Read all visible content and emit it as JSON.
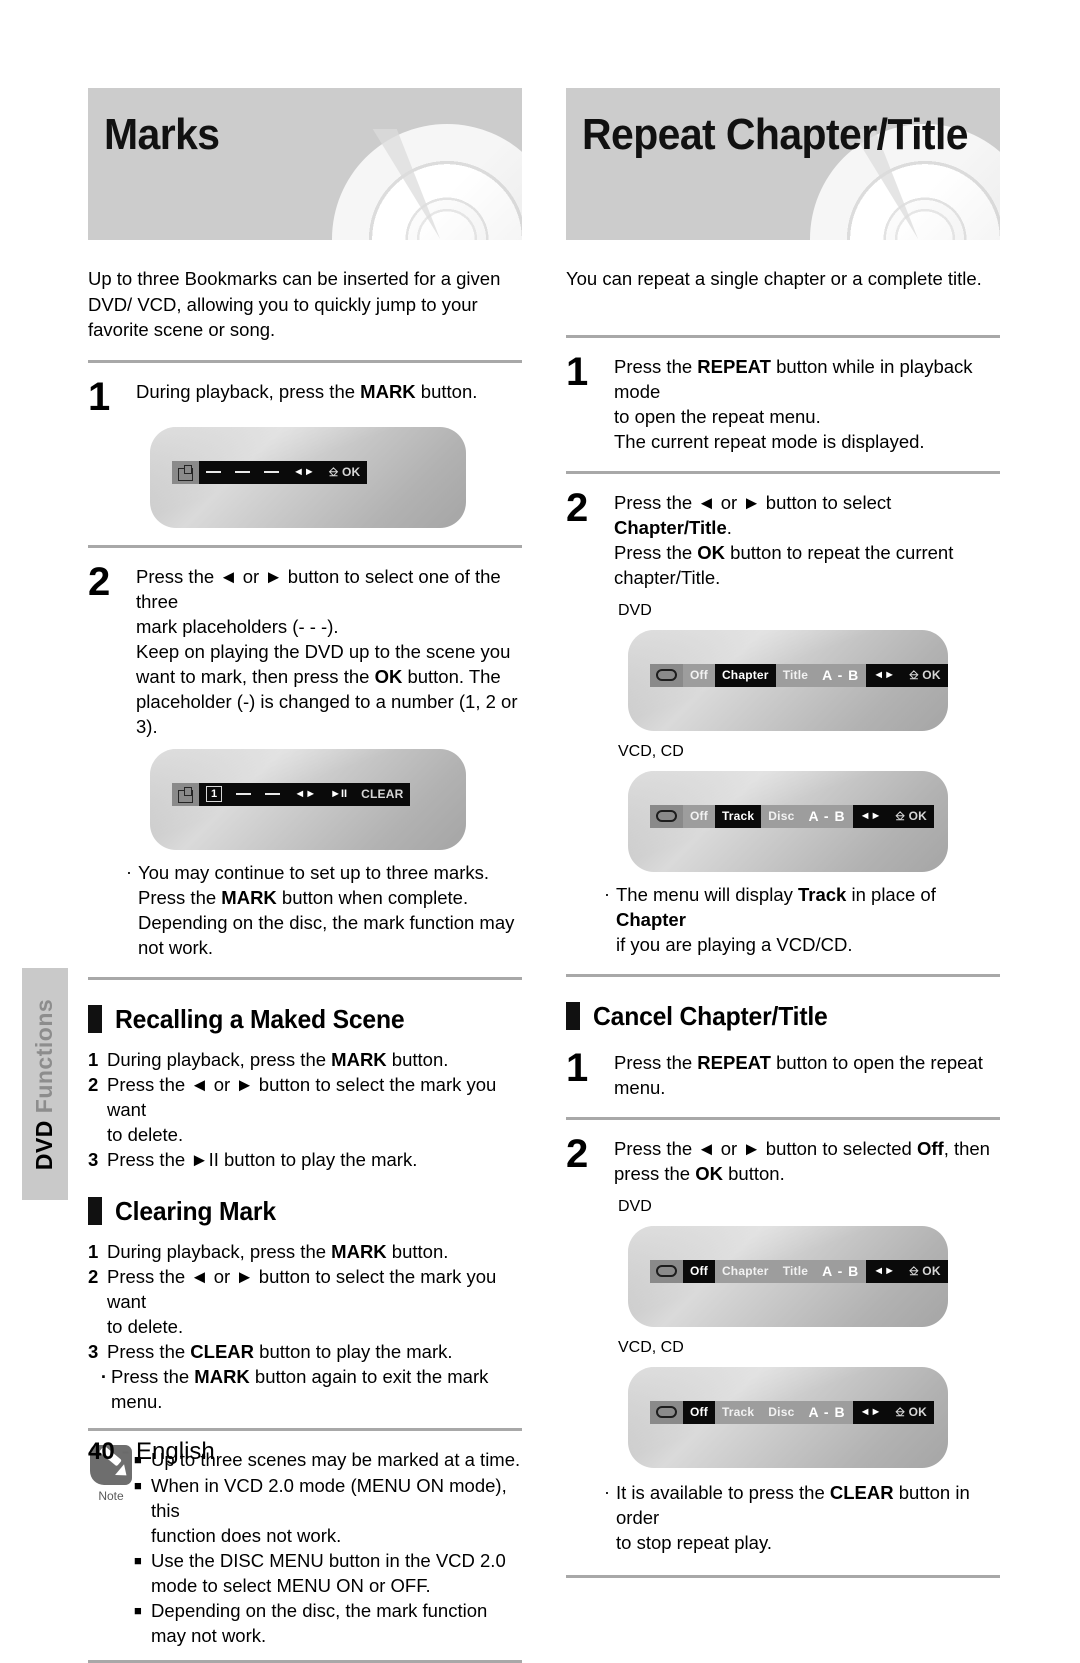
{
  "side_tab": {
    "bold_part": "DVD",
    "light_part": "Functions"
  },
  "footer": {
    "page_number": "40",
    "separator": "-",
    "language": "English"
  },
  "left": {
    "banner_title": "Marks",
    "intro": "Up to three Bookmarks can be inserted for a given DVD/ VCD, allowing you to quickly jump to your favorite scene or song.",
    "step1": {
      "number": "1",
      "line1_a": "During playback, press the ",
      "line1_b": "MARK",
      "line1_c": " button."
    },
    "osd1": {
      "icon": "mark-icon",
      "slot1": "–",
      "slot2": "–",
      "slot3": "–",
      "nav": "◄►",
      "enter": "OK"
    },
    "step2": {
      "number": "2",
      "l1a": "Press the ",
      "l1b": "◄",
      "l1c": " or ",
      "l1d": "►",
      "l1e": " button to select one of the three",
      "l2": "mark placeholders (- - -).",
      "l3": "Keep on playing the DVD up to the scene you",
      "l4a": "want to mark, then press the ",
      "l4b": "OK",
      "l4c": " button. The",
      "l5": "placeholder (-) is changed to a number (1, 2 or 3)."
    },
    "osd2": {
      "icon": "mark-icon",
      "slot1": "1",
      "slot2": "–",
      "slot3": "–",
      "nav": "◄►",
      "play": "►II",
      "clear": "CLEAR"
    },
    "bullet1": {
      "dot": "·",
      "l1": "You may continue to set up to three marks.",
      "l2a": "Press the ",
      "l2b": "MARK",
      "l2c": " button when complete.",
      "l3": "Depending on the disc, the mark function may",
      "l4": "not work."
    },
    "section_recall": {
      "title": "Recalling a Maked Scene",
      "items": [
        {
          "n": "1",
          "a": "During playback, press the ",
          "b": "MARK",
          "c": " button."
        },
        {
          "n": "2",
          "a": "Press the ◄ or ► button to select the mark you want",
          "b": "",
          "c": ""
        },
        {
          "n": "",
          "a": "to delete.",
          "b": "",
          "c": ""
        },
        {
          "n": "3",
          "a": "Press the ►II button to play the mark.",
          "b": "",
          "c": ""
        }
      ]
    },
    "section_clear": {
      "title": "Clearing Mark",
      "items": [
        {
          "n": "1",
          "a": "During playback, press the ",
          "b": "MARK",
          "c": " button."
        },
        {
          "n": "2",
          "a": "Press the ◄ or ► button to select the mark you want",
          "b": "",
          "c": ""
        },
        {
          "n": "",
          "a": "to delete.",
          "b": "",
          "c": ""
        },
        {
          "n": "3",
          "a": "Press the ",
          "b": "CLEAR",
          "c": " button to play the mark."
        }
      ],
      "sub_bullet": {
        "dot": "·",
        "a": "Press the ",
        "b": "MARK",
        "c": " button again to exit the mark menu."
      }
    },
    "note": {
      "word": "Note",
      "items": [
        {
          "sq": "■",
          "lines": [
            "Up to three scenes may be marked at a time."
          ]
        },
        {
          "sq": "■",
          "lines": [
            "When in VCD 2.0 mode (MENU ON mode), this",
            "function does not work."
          ]
        },
        {
          "sq": "■",
          "lines": [
            "Use the DISC MENU button in the VCD 2.0",
            "mode to select MENU ON or OFF."
          ]
        },
        {
          "sq": "■",
          "lines": [
            "Depending on the disc, the mark function",
            "may not work."
          ]
        }
      ]
    }
  },
  "right": {
    "banner_title": "Repeat Chapter/Title",
    "intro": "You can repeat a single chapter or a complete title.",
    "step1": {
      "number": "1",
      "l1a": "Press the ",
      "l1b": "REPEAT",
      "l1c": " button while in playback mode",
      "l2": "to open the repeat menu.",
      "l3": "The current repeat mode is displayed."
    },
    "step2": {
      "number": "2",
      "l1a": "Press the ◄ or ► button to select ",
      "l1b": "Chapter/Title",
      "l1c": ".",
      "l2a": "Press the ",
      "l2b": "OK",
      "l2c": " button to repeat the current",
      "l3": "chapter/Title."
    },
    "osd_dvd_label": "DVD",
    "osd_dvd": {
      "icon": "repeat-loop-icon",
      "off": "Off",
      "mid": "Chapter",
      "right": "Title",
      "ab": "A - B",
      "nav": "◄►",
      "enter": "OK"
    },
    "osd_vcd_label": "VCD, CD",
    "osd_vcd": {
      "icon": "repeat-loop-icon",
      "off": "Off",
      "mid": "Track",
      "right": "Disc",
      "ab": "A - B",
      "nav": "◄►",
      "enter": "OK"
    },
    "bullet1": {
      "dot": "·",
      "l1a": "The menu will display ",
      "l1b": "Track",
      "l1c": " in place of ",
      "l1d": "Chapter",
      "l2": "if you are playing a VCD/CD."
    },
    "section_cancel": {
      "title": "Cancel Chapter/Title"
    },
    "cstep1": {
      "number": "1",
      "l1a": "Press the ",
      "l1b": "REPEAT",
      "l1c": " button to open the repeat",
      "l2": "menu."
    },
    "cstep2": {
      "number": "2",
      "l1a": "Press the ◄ or ► button to selected ",
      "l1b": "Off",
      "l1c": ", then",
      "l2a": "press the ",
      "l2b": "OK",
      "l2c": " button."
    },
    "osd_dvd2_label": "DVD",
    "osd_dvd2": {
      "icon": "repeat-loop-icon",
      "off": "Off",
      "mid": "Chapter",
      "right": "Title",
      "ab": "A - B",
      "nav": "◄►",
      "enter": "OK"
    },
    "osd_vcd2_label": "VCD, CD",
    "osd_vcd2": {
      "icon": "repeat-loop-icon",
      "off": "Off",
      "mid": "Track",
      "right": "Disc",
      "ab": "A - B",
      "nav": "◄►",
      "enter": "OK"
    },
    "bullet2": {
      "dot": "·",
      "l1a": "It is available to press the ",
      "l1b": "CLEAR",
      "l1c": " button in order",
      "l2": "to stop repeat play."
    }
  }
}
